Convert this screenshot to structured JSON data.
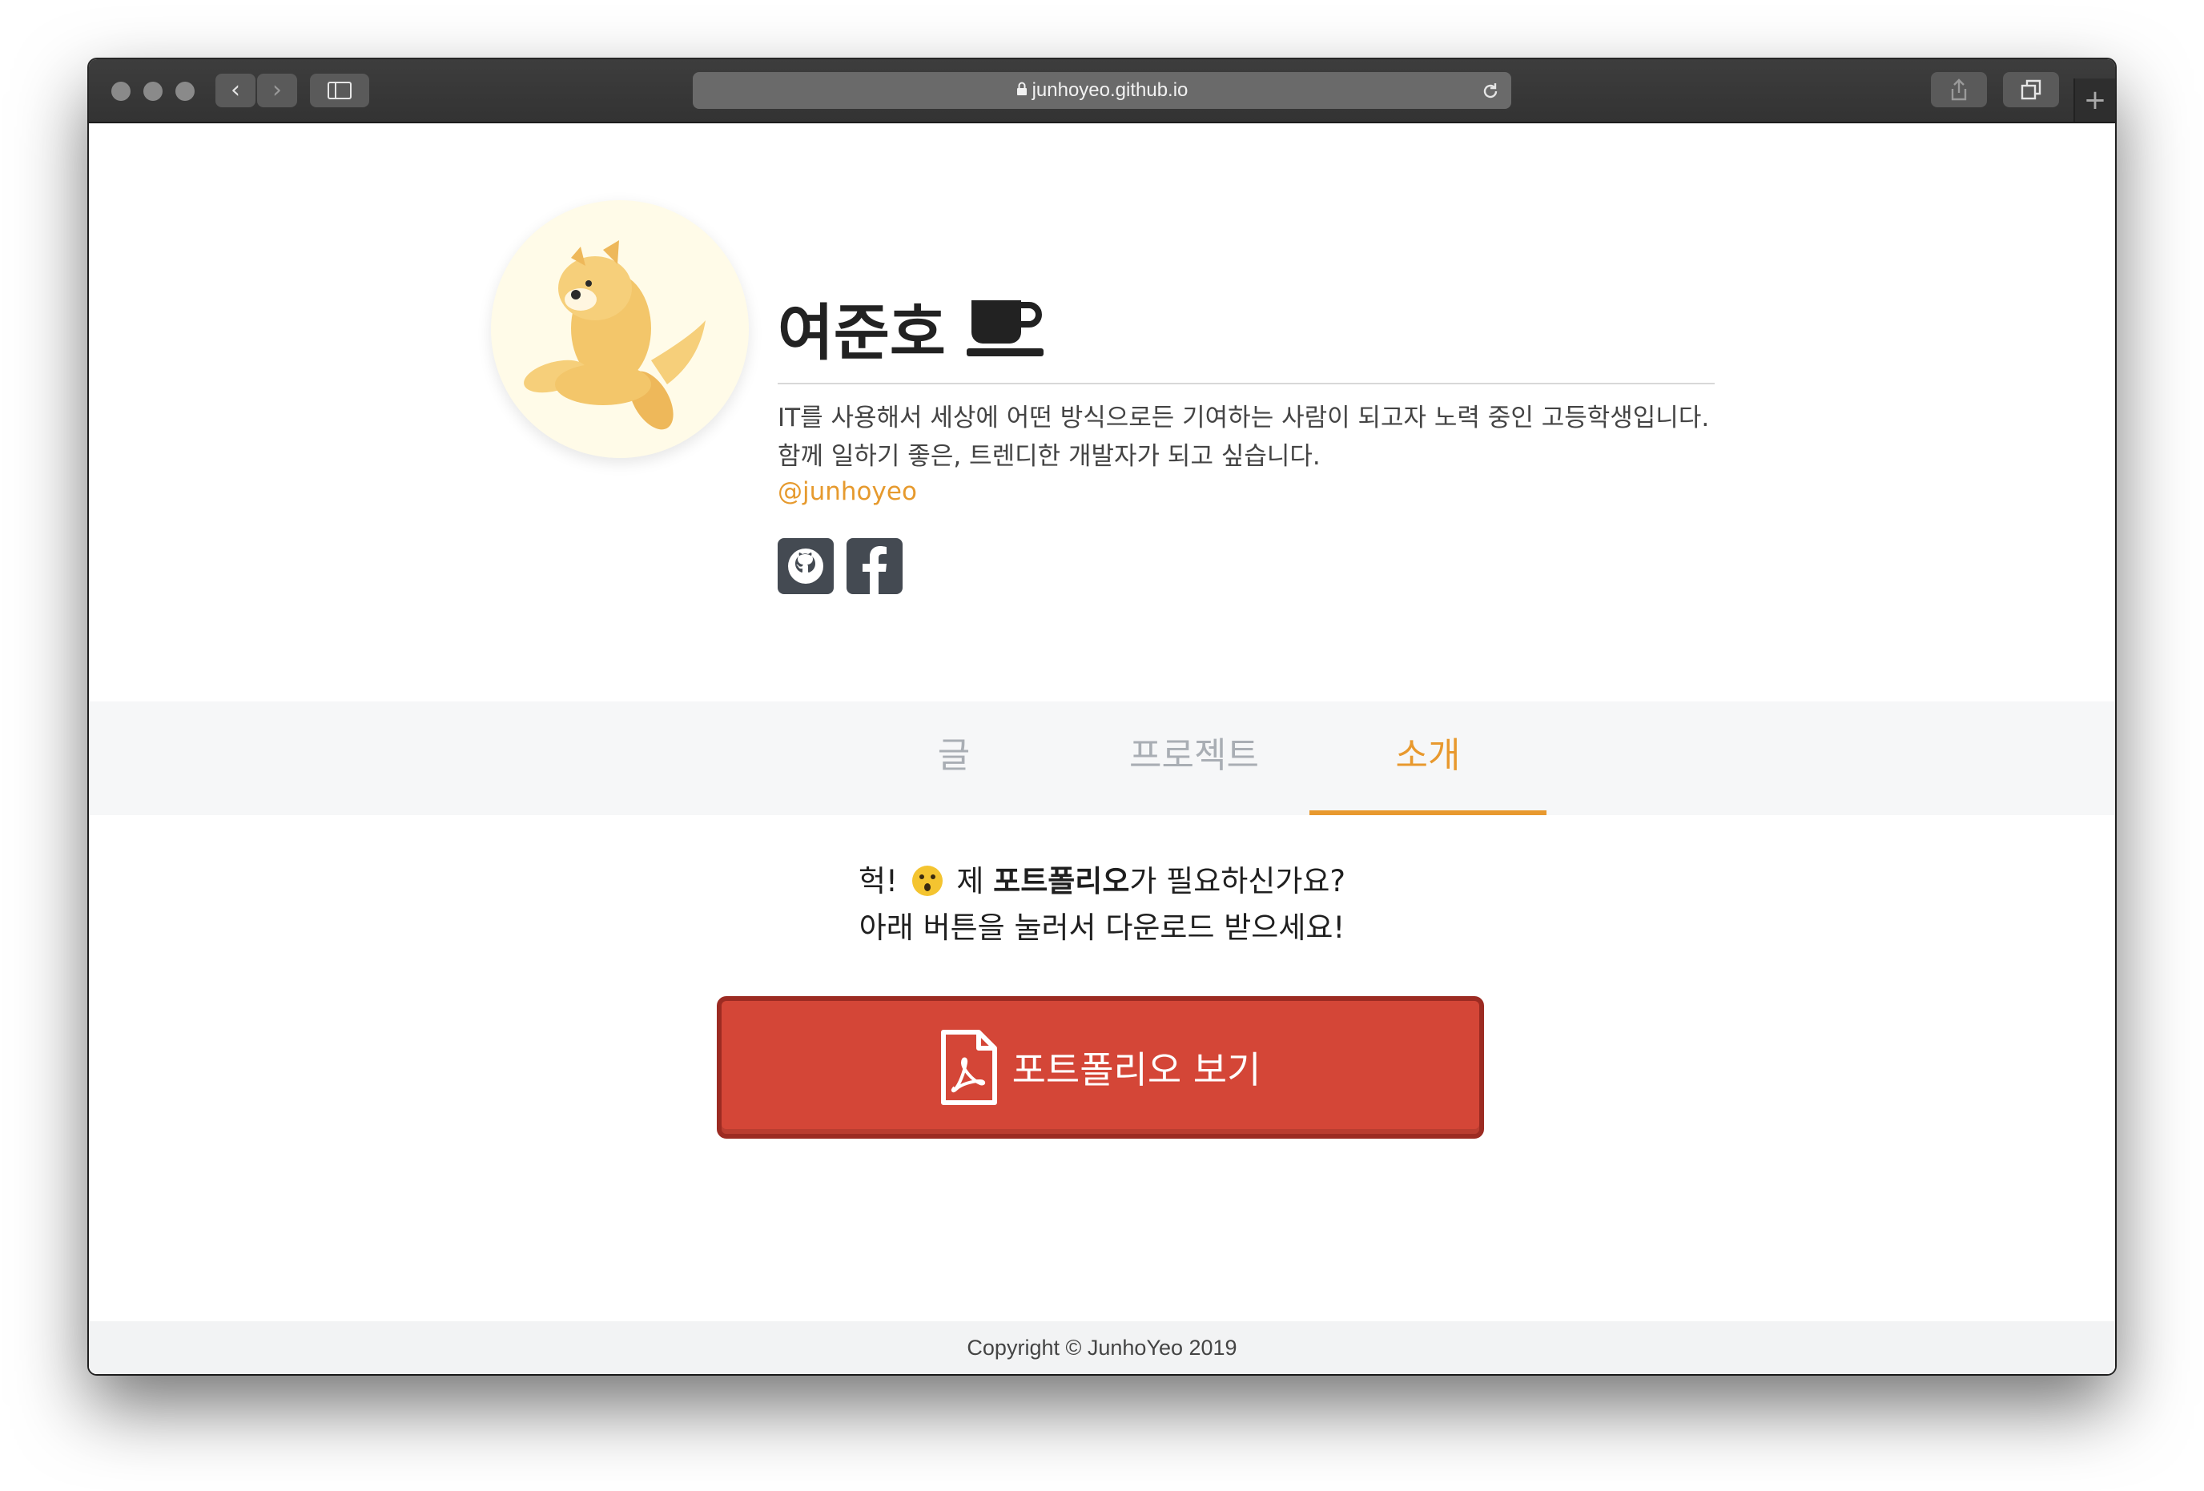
{
  "browser": {
    "url": "junhoyeo.github.io",
    "back_glyph": "‹",
    "forward_glyph": "›",
    "new_tab_glyph": "+"
  },
  "profile": {
    "name": "여준호",
    "bio_line1": "IT를 사용해서 세상에 어떤 방식으로든 기여하는 사람이 되고자 노력 중인 고등학생입니다.",
    "bio_line2": "함께 일하기 좋은, 트렌디한 개발자가 되고 싶습니다.",
    "handle": "@junhoyeo",
    "social": [
      "github-icon",
      "facebook-icon"
    ],
    "accent_color": "#e8992e"
  },
  "tabs": [
    {
      "label": "글",
      "active": false
    },
    {
      "label": "프로젝트",
      "active": false
    },
    {
      "label": "소개",
      "active": true
    }
  ],
  "intro": {
    "line1_prefix": "헉!",
    "line1_mid": "제",
    "line1_bold": "포트폴리오",
    "line1_suffix": "가 필요하신가요?",
    "line2": "아래 버튼을 눌러서 다운로드 받으세요!"
  },
  "portfolio_button": {
    "label": "포트폴리오 보기",
    "icon": "pdf-file-icon",
    "color": "#d44637"
  },
  "footer": {
    "text": "Copyright © JunhoYeo 2019"
  }
}
